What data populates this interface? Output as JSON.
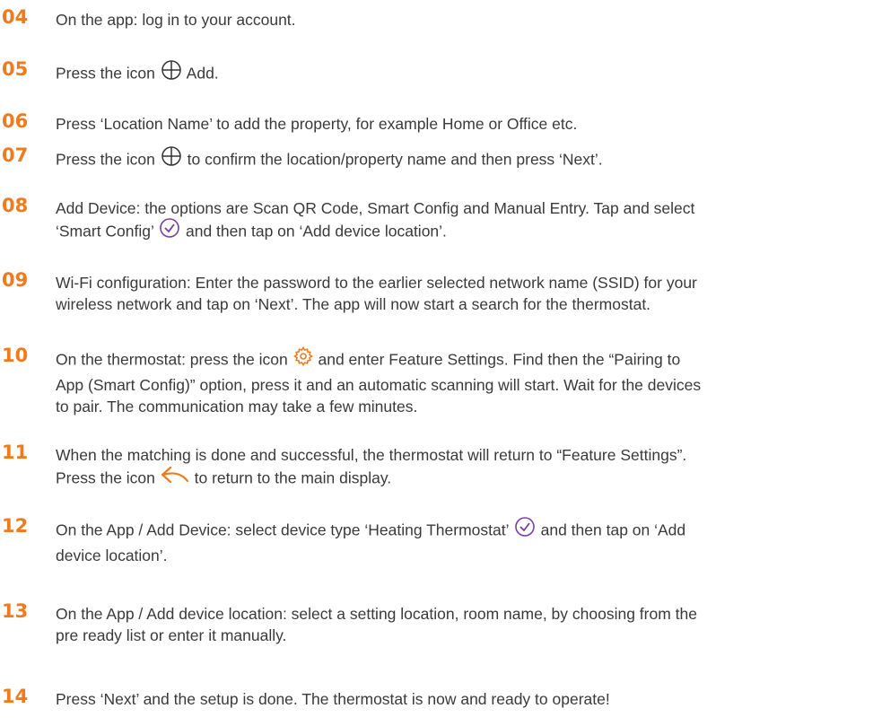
{
  "steps": [
    {
      "number": "04",
      "lines": [
        "On the app: log in to your account."
      ]
    },
    {
      "number": "05",
      "parts": [
        "Press the icon",
        "Add."
      ],
      "icons": [
        "plus-circle-icon"
      ]
    },
    {
      "number": "06",
      "lines": [
        "Press ‘Location Name’ to add the property, for example Home or Office etc."
      ]
    },
    {
      "number": "07",
      "parts": [
        "Press the icon",
        "to confirm the location/property name and then press ‘Next’."
      ],
      "icons": [
        "plus-circle-icon"
      ]
    },
    {
      "number": "08",
      "lines": [
        "Add Device: the options are Scan QR Code, Smart Config and Manual Entry. Tap and select"
      ],
      "parts": [
        "‘Smart Config’",
        "and then tap on ‘Add device location’."
      ],
      "icons": [
        "check-circle-icon"
      ]
    },
    {
      "number": "09",
      "lines": [
        "Wi-Fi configuration: Enter the password to the earlier selected network name (SSID) for your",
        "wireless network and tap on ‘Next’. The app will now start a search for the thermostat."
      ]
    },
    {
      "number": "10",
      "parts": [
        "On the thermostat: press the icon",
        "and enter Feature Settings. Find then the “Pairing to"
      ],
      "lines": [
        "App (Smart Config)” option, press it and an automatic scanning will start. Wait for the devices",
        "to pair. The communication may take a few minutes."
      ],
      "icons": [
        "gear-icon"
      ]
    },
    {
      "number": "11",
      "lines": [
        "When the matching is done and successful, the thermostat will return to “Feature Settings”."
      ],
      "parts": [
        "Press the icon",
        "to return to the main display."
      ],
      "icons": [
        "back-arrow-icon"
      ]
    },
    {
      "number": "12",
      "parts": [
        "On the App / Add Device: select device type ‘Heating Thermostat’",
        "and then tap on ‘Add"
      ],
      "lines": [
        "device location’."
      ],
      "icons": [
        "check-circle-icon"
      ]
    },
    {
      "number": "13",
      "lines": [
        "On the App / Add device location: select a setting location, room name, by choosing from the",
        "pre ready list or enter it manually."
      ]
    },
    {
      "number": "14",
      "lines": [
        "Press ‘Next’ and the setup is done. The thermostat is now and ready to operate!"
      ]
    }
  ],
  "colors": {
    "accent": "#f07a1e",
    "text": "#3a3a3a"
  }
}
